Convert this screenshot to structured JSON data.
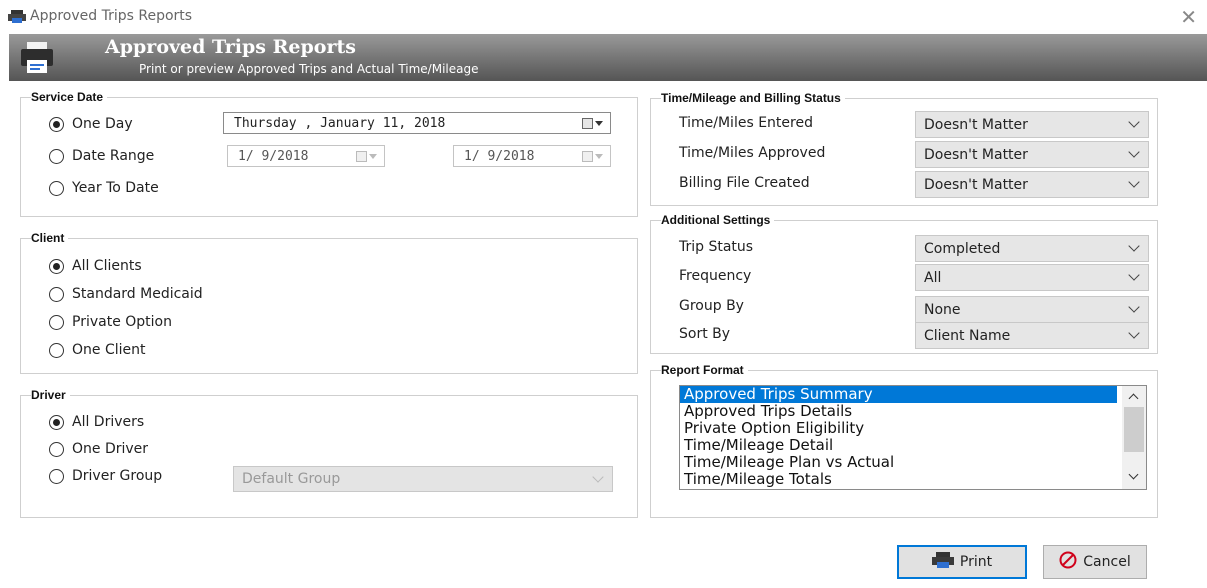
{
  "window": {
    "title": "Approved Trips Reports",
    "close_glyph": "✕"
  },
  "banner": {
    "title": "Approved Trips Reports",
    "subtitle": "Print or preview Approved Trips and Actual Time/Mileage"
  },
  "service_date": {
    "label": "Service Date",
    "options": [
      "One Day",
      "Date Range",
      "Year To Date"
    ],
    "selected": "One Day",
    "one_day_value": "Thursday ,   January   11, 2018",
    "range_start": "1/ 9/2018",
    "range_end": "1/ 9/2018"
  },
  "client": {
    "label": "Client",
    "options": [
      "All Clients",
      "Standard Medicaid",
      "Private Option",
      "One Client"
    ],
    "selected": "All Clients"
  },
  "driver": {
    "label": "Driver",
    "options": [
      "All Drivers",
      "One Driver",
      "Driver Group"
    ],
    "selected": "All Drivers",
    "group_value": "Default Group"
  },
  "billing_status": {
    "label": "Time/Mileage and Billing Status",
    "rows": [
      {
        "label": "Time/Miles Entered",
        "value": "Doesn't Matter"
      },
      {
        "label": "Time/Miles Approved",
        "value": "Doesn't Matter"
      },
      {
        "label": "Billing File Created",
        "value": "Doesn't Matter"
      }
    ]
  },
  "additional": {
    "label": "Additional Settings",
    "rows": [
      {
        "label": "Trip Status",
        "value": "Completed"
      },
      {
        "label": "Frequency",
        "value": "All"
      },
      {
        "label": "Group By",
        "value": "None"
      },
      {
        "label": "Sort By",
        "value": "Client Name"
      }
    ]
  },
  "report_format": {
    "label": "Report Format",
    "items": [
      "Approved Trips Summary",
      "Approved Trips Details",
      "Private Option Eligibility",
      "Time/Mileage Detail",
      "Time/Mileage Plan vs Actual",
      "Time/Mileage Totals"
    ],
    "selected_index": 0
  },
  "buttons": {
    "print": "Print",
    "cancel": "Cancel"
  },
  "colors": {
    "selection": "#0078d7",
    "banner": "#7a7a7a",
    "cancel_icon": "#d0021b"
  }
}
